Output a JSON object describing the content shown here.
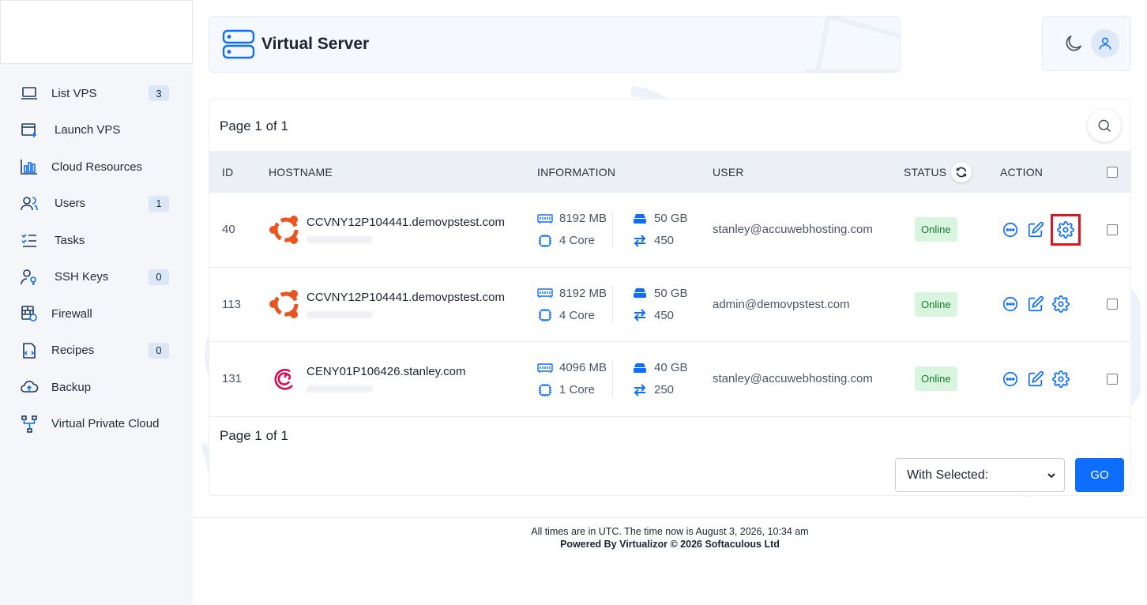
{
  "app": {
    "title": "Virtual Server"
  },
  "sidebar": {
    "items": [
      {
        "label": "List VPS",
        "badge": "3",
        "icon": "laptop-icon"
      },
      {
        "label": "Launch VPS",
        "badge": null,
        "icon": "window-plus-icon"
      },
      {
        "label": "Cloud Resources",
        "badge": null,
        "icon": "bar-chart-icon"
      },
      {
        "label": "Users",
        "badge": "1",
        "icon": "users-icon"
      },
      {
        "label": "Tasks",
        "badge": null,
        "icon": "checklist-icon"
      },
      {
        "label": "SSH Keys",
        "badge": "0",
        "icon": "user-key-icon"
      },
      {
        "label": "Firewall",
        "badge": null,
        "icon": "firewall-icon"
      },
      {
        "label": "Recipes",
        "badge": "0",
        "icon": "file-code-icon"
      },
      {
        "label": "Backup",
        "badge": null,
        "icon": "cloud-upload-icon"
      },
      {
        "label": "Virtual Private Cloud",
        "badge": null,
        "icon": "network-icon"
      }
    ]
  },
  "pagination": {
    "top": "Page 1 of 1",
    "bottom": "Page 1 of 1"
  },
  "table": {
    "headers": {
      "id": "ID",
      "hostname": "HOSTNAME",
      "information": "INFORMATION",
      "user": "USER",
      "status": "STATUS",
      "action": "ACTION"
    },
    "rows": [
      {
        "id": "40",
        "os": "ubuntu",
        "hostname": "CCVNY12P104441.demovpstest.com",
        "ram": "8192 MB",
        "disk": "50 GB",
        "cpu": "4 Core",
        "bandwidth": "450",
        "user": "stanley@accuwebhosting.com",
        "status": "Online"
      },
      {
        "id": "113",
        "os": "ubuntu",
        "hostname": "CCVNY12P104441.demovpstest.com",
        "ram": "8192 MB",
        "disk": "50 GB",
        "cpu": "4 Core",
        "bandwidth": "450",
        "user": "admin@demovpstest.com",
        "status": "Online"
      },
      {
        "id": "131",
        "os": "debian",
        "hostname": "CENY01P106426.stanley.com",
        "ram": "4096 MB",
        "disk": "40 GB",
        "cpu": "1 Core",
        "bandwidth": "250",
        "user": "stanley@accuwebhosting.com",
        "status": "Online"
      }
    ]
  },
  "bulk": {
    "selected": "With Selected:",
    "go_label": "GO"
  },
  "footer": {
    "time": "All times are in UTC. The time now is August 3, 2026, 10:34 am",
    "powered": "Powered By Virtualizor © 2026 Softaculous Ltd"
  },
  "colors": {
    "accent": "#0d6efd",
    "online_bg": "#d9f5df",
    "online_text": "#167a2e",
    "highlight": "#e0131e",
    "ubuntu": "#e95420",
    "debian": "#d70a53"
  }
}
